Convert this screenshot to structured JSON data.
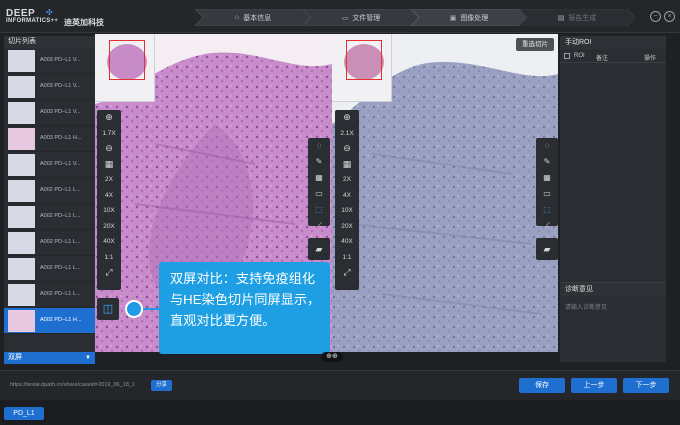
{
  "header": {
    "logo_line1": "DEEP",
    "logo_line2": "INFORMATICS++",
    "logo_cn": "迪英加科技",
    "steps": [
      {
        "label": "基本信息",
        "icon": "home-icon",
        "state": "active"
      },
      {
        "label": "文件管理",
        "icon": "folder-icon",
        "state": "active"
      },
      {
        "label": "图像处理",
        "icon": "image-icon",
        "state": "active"
      },
      {
        "label": "报告生成",
        "icon": "report-icon",
        "state": "done"
      }
    ],
    "minimize": "−",
    "close": "×"
  },
  "slide_list": {
    "title": "切片列表",
    "items": [
      {
        "label": "A003 PD−L1 V...",
        "thumb": "pd"
      },
      {
        "label": "A003 PD−L1 V...",
        "thumb": "pd"
      },
      {
        "label": "A003 PD−L1 V...",
        "thumb": "pd"
      },
      {
        "label": "A003 PD−L1 H...",
        "thumb": "he"
      },
      {
        "label": "A002 PD−L1 V...",
        "thumb": "pd"
      },
      {
        "label": "A002 PD−L1 L...",
        "thumb": "pd"
      },
      {
        "label": "A002 PD−L1 L...",
        "thumb": "pd"
      },
      {
        "label": "A002 PD−L1 L...",
        "thumb": "pd"
      },
      {
        "label": "A002 PD−L1 L...",
        "thumb": "pd"
      },
      {
        "label": "A002 PD−L1 L...",
        "thumb": "pd"
      },
      {
        "label": "A002 PD−L1 H...",
        "thumb": "he",
        "active": true
      }
    ],
    "mode": "双屏",
    "mode_caret": "▼"
  },
  "viewer_left": {
    "zoom_readout": "1.7X",
    "zoom_levels": [
      "2X",
      "4X",
      "10X",
      "20X",
      "40X",
      "1:1"
    ],
    "tissue_color": "#c58ac6"
  },
  "viewer_right": {
    "reselect_label": "重选切片",
    "zoom_readout": "2.1X",
    "zoom_levels": [
      "2X",
      "4X",
      "10X",
      "20X",
      "40X",
      "1:1"
    ],
    "tissue_color": "#8e93b8"
  },
  "callout": {
    "text": "双屏对比：支持免疫组化与HE染色切片同屏显示，直观对比更方便。",
    "color": "#1e9fe4"
  },
  "roi_panel": {
    "title": "手动ROI",
    "col_roi": "ROI",
    "col_note": "备注",
    "col_action": "操作"
  },
  "diagnosis": {
    "title": "诊断意见",
    "placeholder": "请输入诊断意见"
  },
  "footer": {
    "url": "https://testai.dpath.cn/share/caseid=2019_06_18_1",
    "share_label": "分享",
    "save_label": "保存",
    "prev_label": "上一步",
    "next_label": "下一步"
  },
  "tabs": [
    "PD_L1"
  ],
  "colors": {
    "accent": "#1f6fd1",
    "panel": "#2a2d31",
    "background": "#1e2023"
  }
}
